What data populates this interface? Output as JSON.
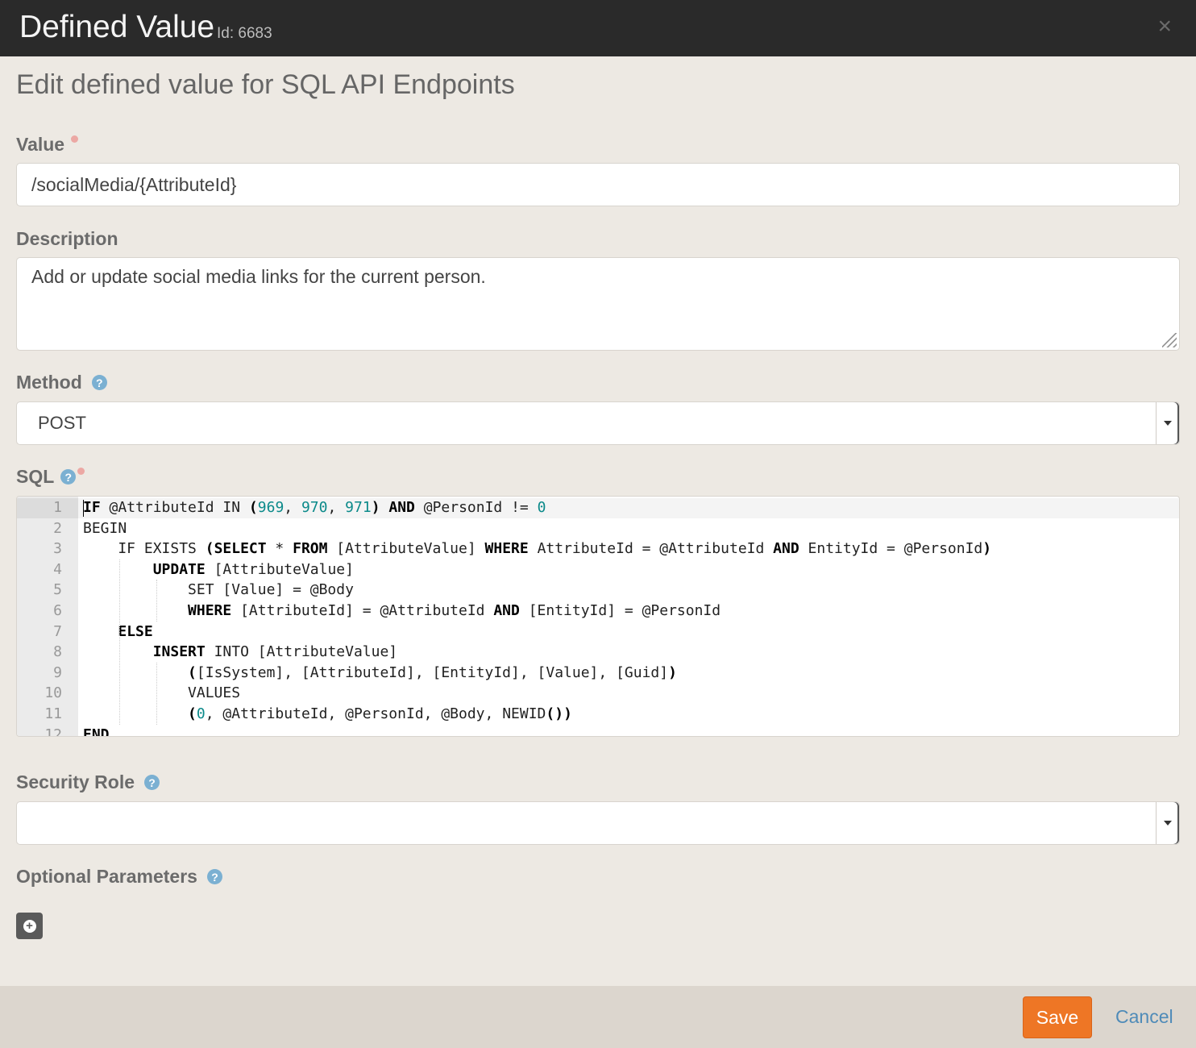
{
  "header": {
    "title": "Defined Value",
    "id_label": "Id: 6683",
    "close_icon": "×"
  },
  "subtitle": "Edit defined value for SQL API Endpoints",
  "fields": {
    "value": {
      "label": "Value",
      "required": true,
      "value": "/socialMedia/{AttributeId}"
    },
    "description": {
      "label": "Description",
      "value": "Add or update social media links for the current person."
    },
    "method": {
      "label": "Method",
      "selected": "POST"
    },
    "sql": {
      "label": "SQL",
      "required": true
    },
    "security_role": {
      "label": "Security Role",
      "selected": ""
    },
    "optional_parameters": {
      "label": "Optional Parameters"
    }
  },
  "sql_lines": [
    {
      "n": "1",
      "code": "IF @AttributeId IN (969, 970, 971) AND @PersonId != 0"
    },
    {
      "n": "2",
      "code": "BEGIN"
    },
    {
      "n": "3",
      "code": "    IF EXISTS (SELECT * FROM [AttributeValue] WHERE AttributeId = @AttributeId AND EntityId = @PersonId)"
    },
    {
      "n": "4",
      "code": "        UPDATE [AttributeValue]"
    },
    {
      "n": "5",
      "code": "            SET [Value] = @Body"
    },
    {
      "n": "6",
      "code": "            WHERE [AttributeId] = @AttributeId AND [EntityId] = @PersonId"
    },
    {
      "n": "7",
      "code": "    ELSE"
    },
    {
      "n": "8",
      "code": "        INSERT INTO [AttributeValue]"
    },
    {
      "n": "9",
      "code": "            ([IsSystem], [AttributeId], [EntityId], [Value], [Guid])"
    },
    {
      "n": "10",
      "code": "            VALUES"
    },
    {
      "n": "11",
      "code": "            (0, @AttributeId, @PersonId, @Body, NEWID())"
    },
    {
      "n": "12",
      "code": "END"
    }
  ],
  "footer": {
    "save_label": "Save",
    "cancel_label": "Cancel"
  },
  "colors": {
    "header_bg": "#2a2a2a",
    "page_bg": "#ede9e3",
    "save_button": "#ee7625",
    "cancel_link": "#4f8bb8",
    "help_icon": "#7bb0d2",
    "required_dot": "#eca8a4",
    "sql_number": "#0b8a8a"
  }
}
